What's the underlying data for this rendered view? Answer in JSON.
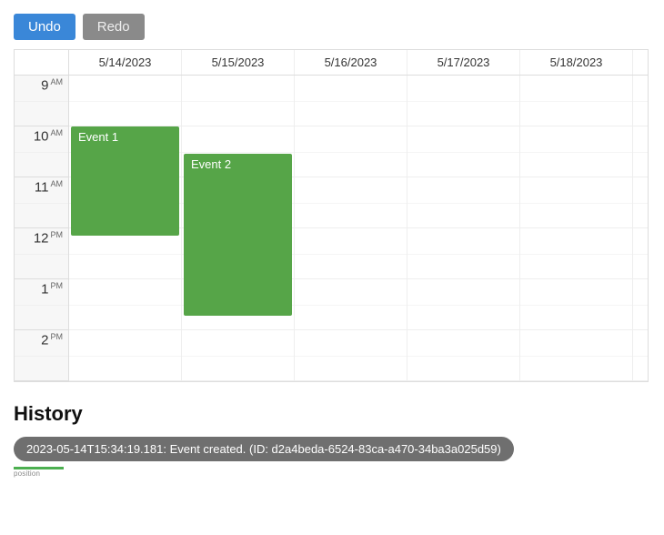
{
  "toolbar": {
    "undo_label": "Undo",
    "redo_label": "Redo"
  },
  "calendar": {
    "days": [
      "5/14/2023",
      "5/15/2023",
      "5/16/2023",
      "5/17/2023",
      "5/18/2023"
    ],
    "hours": [
      {
        "h": "9",
        "ap": "AM"
      },
      {
        "h": "10",
        "ap": "AM"
      },
      {
        "h": "11",
        "ap": "AM"
      },
      {
        "h": "12",
        "ap": "PM"
      },
      {
        "h": "1",
        "ap": "PM"
      },
      {
        "h": "2",
        "ap": "PM"
      }
    ],
    "events": [
      {
        "label": "Event 1"
      },
      {
        "label": "Event 2"
      }
    ]
  },
  "history": {
    "title": "History",
    "items": [
      "2023-05-14T15:34:19.181: Event created. (ID: d2a4beda-6524-83ca-a470-34ba3a025d59)"
    ],
    "position_label": "position"
  }
}
